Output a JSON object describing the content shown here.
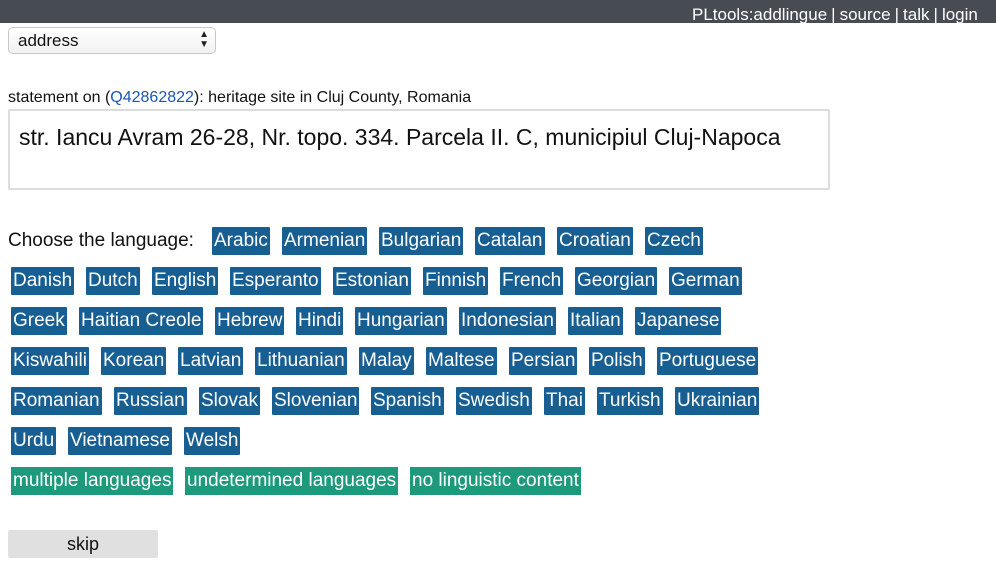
{
  "topbar": {
    "links": [
      "PLtools:addlingue",
      "source",
      "talk",
      "login"
    ]
  },
  "property_select": {
    "value": "address"
  },
  "statement": {
    "prefix": "statement on (",
    "item_id": "Q42862822",
    "suffix": "): heritage site in Cluj County, Romania"
  },
  "value_text": "str. Iancu Avram 26-28, Nr. topo. 334. Parcela II. C, municipiul Cluj-Napoca",
  "choose_label": "Choose the language:",
  "languages": [
    "Arabic",
    "Armenian",
    "Bulgarian",
    "Catalan",
    "Croatian",
    "Czech",
    "Danish",
    "Dutch",
    "English",
    "Esperanto",
    "Estonian",
    "Finnish",
    "French",
    "Georgian",
    "German",
    "Greek",
    "Haitian Creole",
    "Hebrew",
    "Hindi",
    "Hungarian",
    "Indonesian",
    "Italian",
    "Japanese",
    "Kiswahili",
    "Korean",
    "Latvian",
    "Lithuanian",
    "Malay",
    "Maltese",
    "Persian",
    "Polish",
    "Portuguese",
    "Romanian",
    "Russian",
    "Slovak",
    "Slovenian",
    "Spanish",
    "Swedish",
    "Thai",
    "Turkish",
    "Ukrainian",
    "Urdu",
    "Vietnamese",
    "Welsh"
  ],
  "special_options": [
    "multiple languages",
    "undetermined languages",
    "no linguistic content"
  ],
  "skip_label": "skip",
  "colors": {
    "topbar_bg": "#474b52",
    "language_button": "#175f93",
    "special_button": "#1c9a7b",
    "link": "#1a55b5"
  }
}
